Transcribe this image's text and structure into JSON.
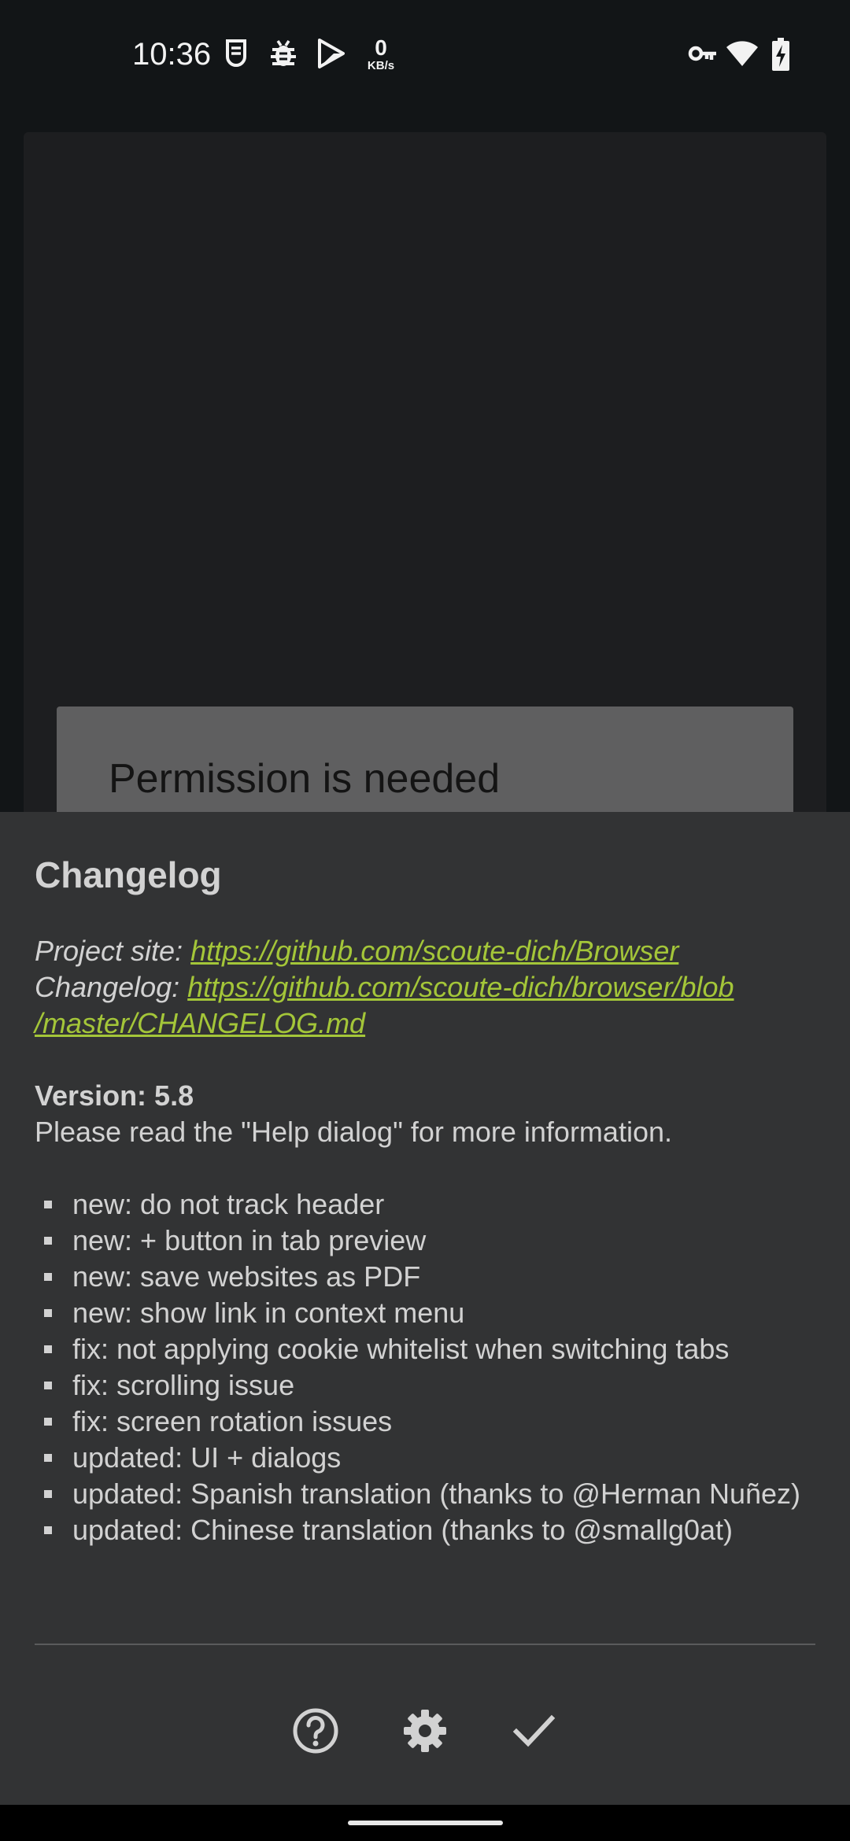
{
  "status_bar": {
    "time": "10:36",
    "net_speed_value": "0",
    "net_speed_unit": "KB/s",
    "left_icons": [
      "notification-icon",
      "bug-icon",
      "play-store-icon"
    ],
    "right_icons": [
      "vpn-key-icon",
      "wifi-icon",
      "battery-charging-icon"
    ]
  },
  "background_dialog": {
    "title": "Permission is needed"
  },
  "changelog": {
    "title": "Changelog",
    "project_site_label": "Project site: ",
    "project_site_url": "https://github.com/scoute-dich/Browser",
    "changelog_label": "Changelog: ",
    "changelog_url_line1": "https://github.com/scoute-dich/browser/blob",
    "changelog_url_line2": "/master/CHANGELOG.md",
    "version_label": "Version: 5.8",
    "help_note": "Please read the \"Help dialog\" for more information.",
    "items": [
      "new: do not track header",
      "new: + button in tab preview",
      "new: save websites as PDF",
      "new: show link in context menu",
      "fix: not applying cookie whitelist when switching tabs",
      "fix: scrolling issue",
      "fix: screen rotation issues",
      "updated: UI + dialogs",
      "updated: Spanish translation (thanks to @Herman Nuñez)",
      "updated: Chinese translation (thanks to @smallg0at)"
    ],
    "actions": [
      "help-icon",
      "settings-icon",
      "check-icon"
    ]
  },
  "colors": {
    "background": "#121517",
    "sheet": "#323334",
    "link": "#a4c639",
    "text": "#d2d2d2"
  }
}
